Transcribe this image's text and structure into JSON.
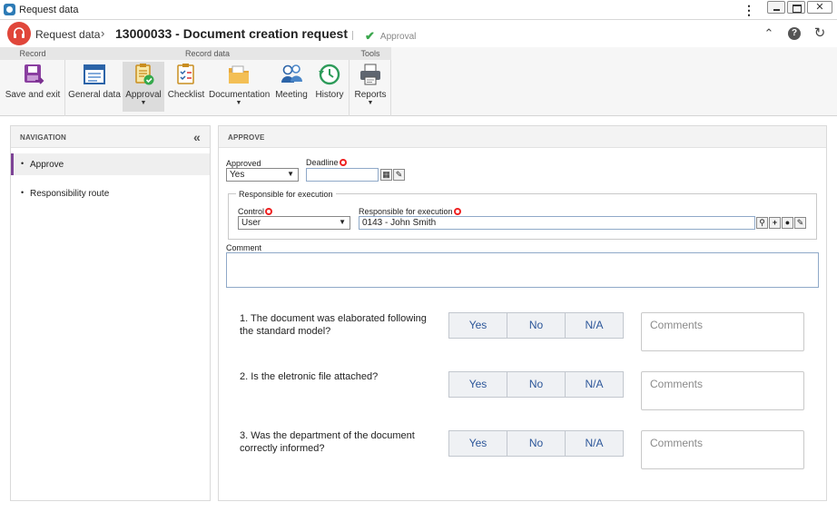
{
  "window": {
    "title": "Request data"
  },
  "header": {
    "breadcrumb": "Request data",
    "separator": "›",
    "doc_title": "13000033 - Document creation request",
    "status_tag": "Approval"
  },
  "ribbon": {
    "groups": {
      "record": "Record",
      "record_data": "Record data",
      "tools": "Tools"
    },
    "buttons": {
      "save_exit": "Save and exit",
      "general_data": "General data",
      "approval": "Approval",
      "checklist": "Checklist",
      "documentation": "Documentation",
      "meeting": "Meeting",
      "history": "History",
      "reports": "Reports"
    }
  },
  "navigation": {
    "title": "NAVIGATION",
    "items": [
      "Approve",
      "Responsibility route"
    ]
  },
  "approve": {
    "title": "APPROVE",
    "approved_label": "Approved",
    "approved_value": "Yes",
    "deadline_label": "Deadline",
    "deadline_value": "",
    "responsible_legend": "Responsible for execution",
    "control_label": "Control",
    "control_value": "User",
    "responsible_label": "Responsible for execution",
    "responsible_value": "0143 - John Smith",
    "comment_label": "Comment",
    "comment_value": ""
  },
  "checklist": {
    "options": [
      "Yes",
      "No",
      "N/A"
    ],
    "comments_placeholder": "Comments",
    "questions": [
      {
        "line1": "1. The document was elaborated following",
        "line2": "the standard model?"
      },
      {
        "line1": "2. Is the eletronic file attached?",
        "line2": ""
      },
      {
        "line1": "3. Was the department of the document",
        "line2": "correctly informed?"
      }
    ]
  },
  "colors": {
    "accent": "#7d4396",
    "logo": "#e0463a",
    "required": "#ee2222",
    "segment_text": "#2c5699"
  }
}
